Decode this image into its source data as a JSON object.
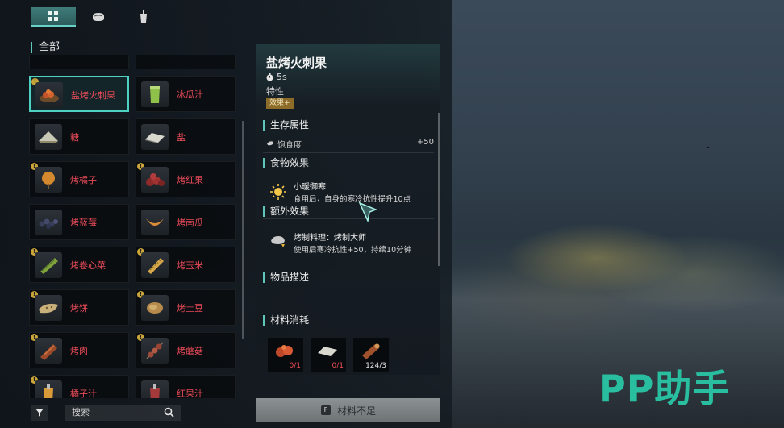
{
  "tabs": [
    {
      "name": "all",
      "icon": "grid-icon",
      "active": true
    },
    {
      "name": "meat",
      "icon": "meat-icon",
      "active": false
    },
    {
      "name": "drink",
      "icon": "cup-icon",
      "active": false
    }
  ],
  "category_title": "全部",
  "items": [
    {
      "label": "盐烤火刺果",
      "icon": "roasted-fruit-icon",
      "badge": true,
      "selected": true
    },
    {
      "label": "冰瓜汁",
      "icon": "juice-icon",
      "badge": false,
      "selected": false
    },
    {
      "label": "糖",
      "icon": "sugar-icon",
      "badge": false,
      "selected": false
    },
    {
      "label": "盐",
      "icon": "salt-icon",
      "badge": false,
      "selected": false
    },
    {
      "label": "烤橘子",
      "icon": "roasted-orange-icon",
      "badge": true,
      "selected": false
    },
    {
      "label": "烤红果",
      "icon": "roasted-redfruit-icon",
      "badge": true,
      "selected": false
    },
    {
      "label": "烤蓝莓",
      "icon": "roasted-blueberry-icon",
      "badge": false,
      "selected": false
    },
    {
      "label": "烤南瓜",
      "icon": "roasted-pumpkin-icon",
      "badge": false,
      "selected": false
    },
    {
      "label": "烤卷心菜",
      "icon": "roasted-cabbage-icon",
      "badge": true,
      "selected": false
    },
    {
      "label": "烤玉米",
      "icon": "roasted-corn-icon",
      "badge": true,
      "selected": false
    },
    {
      "label": "烤饼",
      "icon": "flatbread-icon",
      "badge": true,
      "selected": false
    },
    {
      "label": "烤土豆",
      "icon": "roasted-potato-icon",
      "badge": true,
      "selected": false
    },
    {
      "label": "烤肉",
      "icon": "roasted-meat-icon",
      "badge": true,
      "selected": false
    },
    {
      "label": "烤蘑菇",
      "icon": "roasted-mushroom-icon",
      "badge": true,
      "selected": false
    },
    {
      "label": "橘子汁",
      "icon": "orange-juice-icon",
      "badge": true,
      "selected": false
    },
    {
      "label": "红果汁",
      "icon": "redfruit-juice-icon",
      "badge": false,
      "selected": false
    }
  ],
  "search": {
    "placeholder": "搜索"
  },
  "detail": {
    "title": "盐烤火刺果",
    "time": "5s",
    "trait_label": "特性",
    "trait_chip": "效果+",
    "survival_title": "生存属性",
    "stat_name": "饱食度",
    "stat_value": "+50",
    "food_effect_title": "食物效果",
    "food_effect_name": "小暖御寒",
    "food_effect_desc": "食用后，自身的寒冷抗性提升10点",
    "extra_effect_title": "额外效果",
    "extra_effect_name": "烤制料理：烤制大师",
    "extra_effect_desc": "使用后寒冷抗性+50，持续10分钟",
    "item_desc_title": "物品描述",
    "materials_title": "材料消耗",
    "materials": [
      {
        "icon": "fire-fruit-icon",
        "count": "0/1",
        "insufficient": true
      },
      {
        "icon": "salt-icon",
        "count": "0/1",
        "insufficient": true
      },
      {
        "icon": "wood-log-icon",
        "count": "124/3",
        "insufficient": false
      }
    ]
  },
  "craft_button": {
    "key": "F",
    "label": "材料不足"
  },
  "watermark": "PP助手",
  "colors": {
    "accent": "#4fd1c2",
    "item_label": "#e84a58",
    "watermark": "#29c6a6",
    "chip": "#8d6c2a"
  }
}
